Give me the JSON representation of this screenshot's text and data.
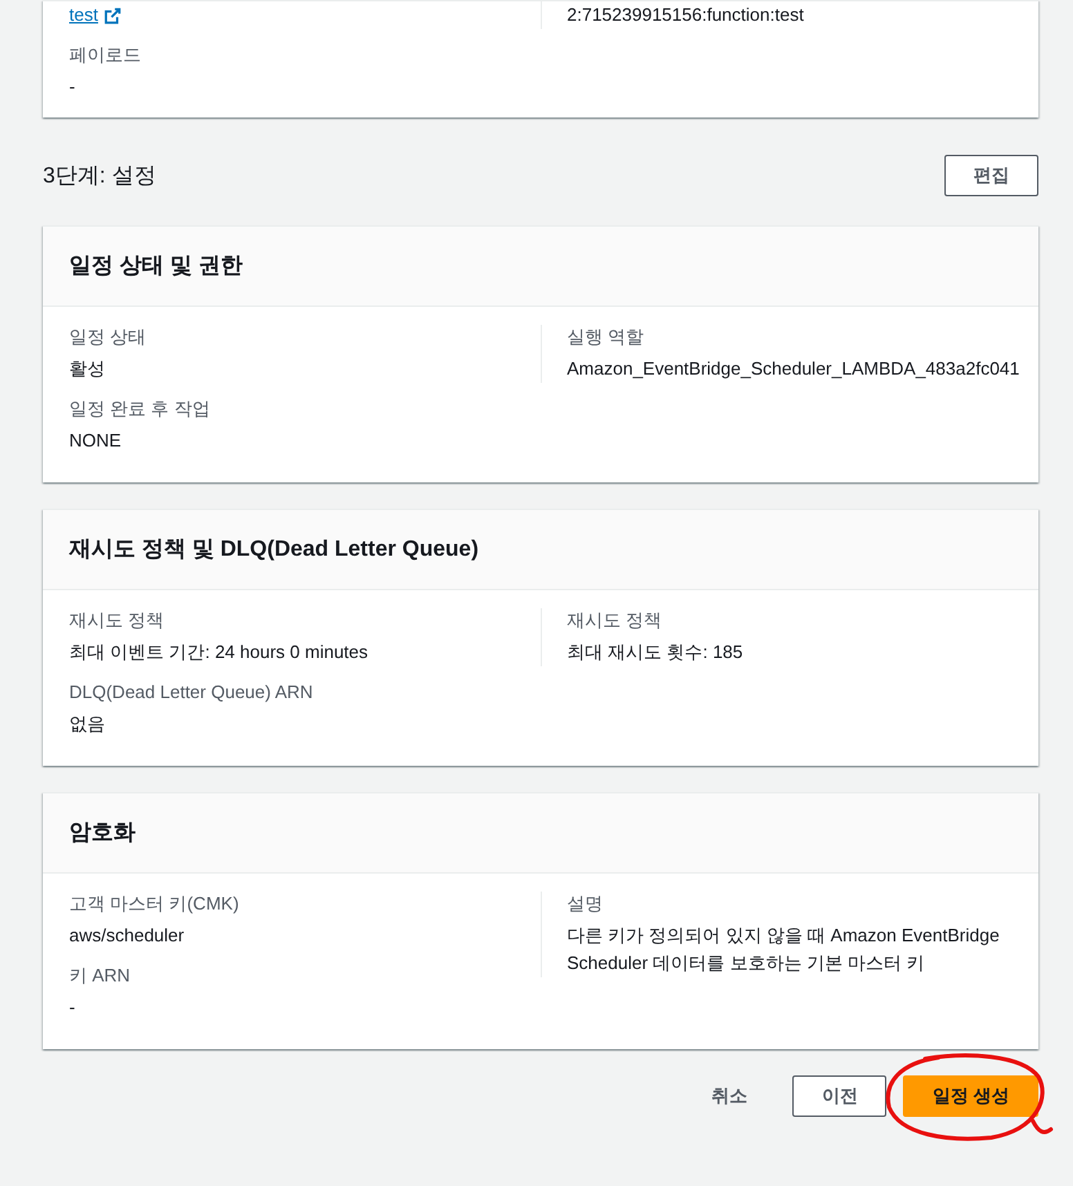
{
  "top_card": {
    "columns": [
      [
        {
          "value": "test",
          "kind": "link"
        },
        {
          "label": "페이로드",
          "value": "-"
        }
      ],
      [
        {
          "value": "2:715239915156:function:test"
        }
      ]
    ]
  },
  "step": {
    "title": "3단계: 설정",
    "edit_button": "편집"
  },
  "cards": [
    {
      "title": "일정 상태 및 권한",
      "columns": [
        [
          {
            "label": "일정 상태",
            "value": "활성"
          },
          {
            "label": "일정 완료 후 작업",
            "value": "NONE"
          }
        ],
        [
          {
            "label": "실행 역할",
            "value": "Amazon_EventBridge_Scheduler_LAMBDA_483a2fc041"
          }
        ]
      ]
    },
    {
      "title": "재시도 정책 및 DLQ(Dead Letter Queue)",
      "columns": [
        [
          {
            "label": "재시도 정책",
            "value": "최대 이벤트 기간: 24 hours 0 minutes"
          },
          {
            "label": "DLQ(Dead Letter Queue) ARN",
            "value": "없음"
          }
        ],
        [
          {
            "label": "재시도 정책",
            "value": "최대 재시도 횟수: 185"
          }
        ]
      ]
    },
    {
      "title": "암호화",
      "columns": [
        [
          {
            "label": "고객 마스터 키(CMK)",
            "value": "aws/scheduler"
          },
          {
            "label": "키 ARN",
            "value": "-"
          }
        ],
        [
          {
            "label": "설명",
            "value": "다른 키가 정의되어 있지 않을 때 Amazon EventBridge Scheduler 데이터를 보호하는 기본 마스터 키"
          }
        ]
      ]
    }
  ],
  "footer": {
    "buttons": [
      {
        "label": "취소",
        "kind": "link"
      },
      {
        "label": "이전",
        "kind": "normal"
      },
      {
        "label": "일정 생성",
        "kind": "primary"
      }
    ]
  }
}
